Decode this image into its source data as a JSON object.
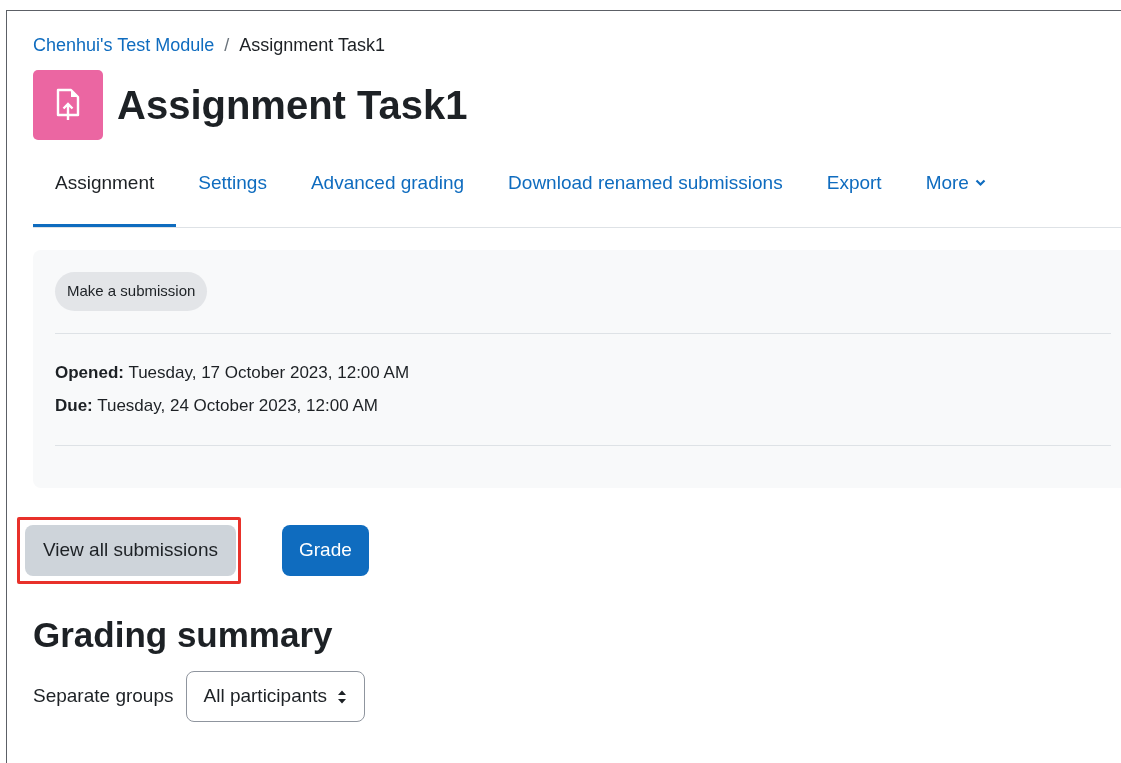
{
  "breadcrumb": [
    {
      "label": "Chenhui's Test Module",
      "kind": "link"
    },
    {
      "label": "/",
      "kind": "separator"
    },
    {
      "label": "Assignment Task1",
      "kind": "current"
    }
  ],
  "page_title": "Assignment Task1",
  "tabs": [
    {
      "label": "Assignment",
      "selected": true
    },
    {
      "label": "Settings",
      "selected": false
    },
    {
      "label": "Advanced grading",
      "selected": false
    },
    {
      "label": "Download renamed submissions",
      "selected": false
    },
    {
      "label": "Export",
      "selected": false
    },
    {
      "label": "More",
      "selected": false,
      "kind": "dropdown"
    }
  ],
  "activity": {
    "button": "Make a submission",
    "dates": [
      {
        "label": "Opened:",
        "value": "Tuesday, 17 October 2023, 12:00 AM"
      },
      {
        "label": "Due:",
        "value": "Tuesday, 24 October 2023, 12:00 AM"
      }
    ]
  },
  "actions": [
    {
      "label": "View all submissions",
      "kind": "secondary",
      "highlighted": true
    },
    {
      "label": "Grade",
      "kind": "primary",
      "highlighted": false
    }
  ],
  "grading_summary": {
    "heading": "Grading summary",
    "group_label": "Separate groups",
    "group_value": "All participants"
  }
}
